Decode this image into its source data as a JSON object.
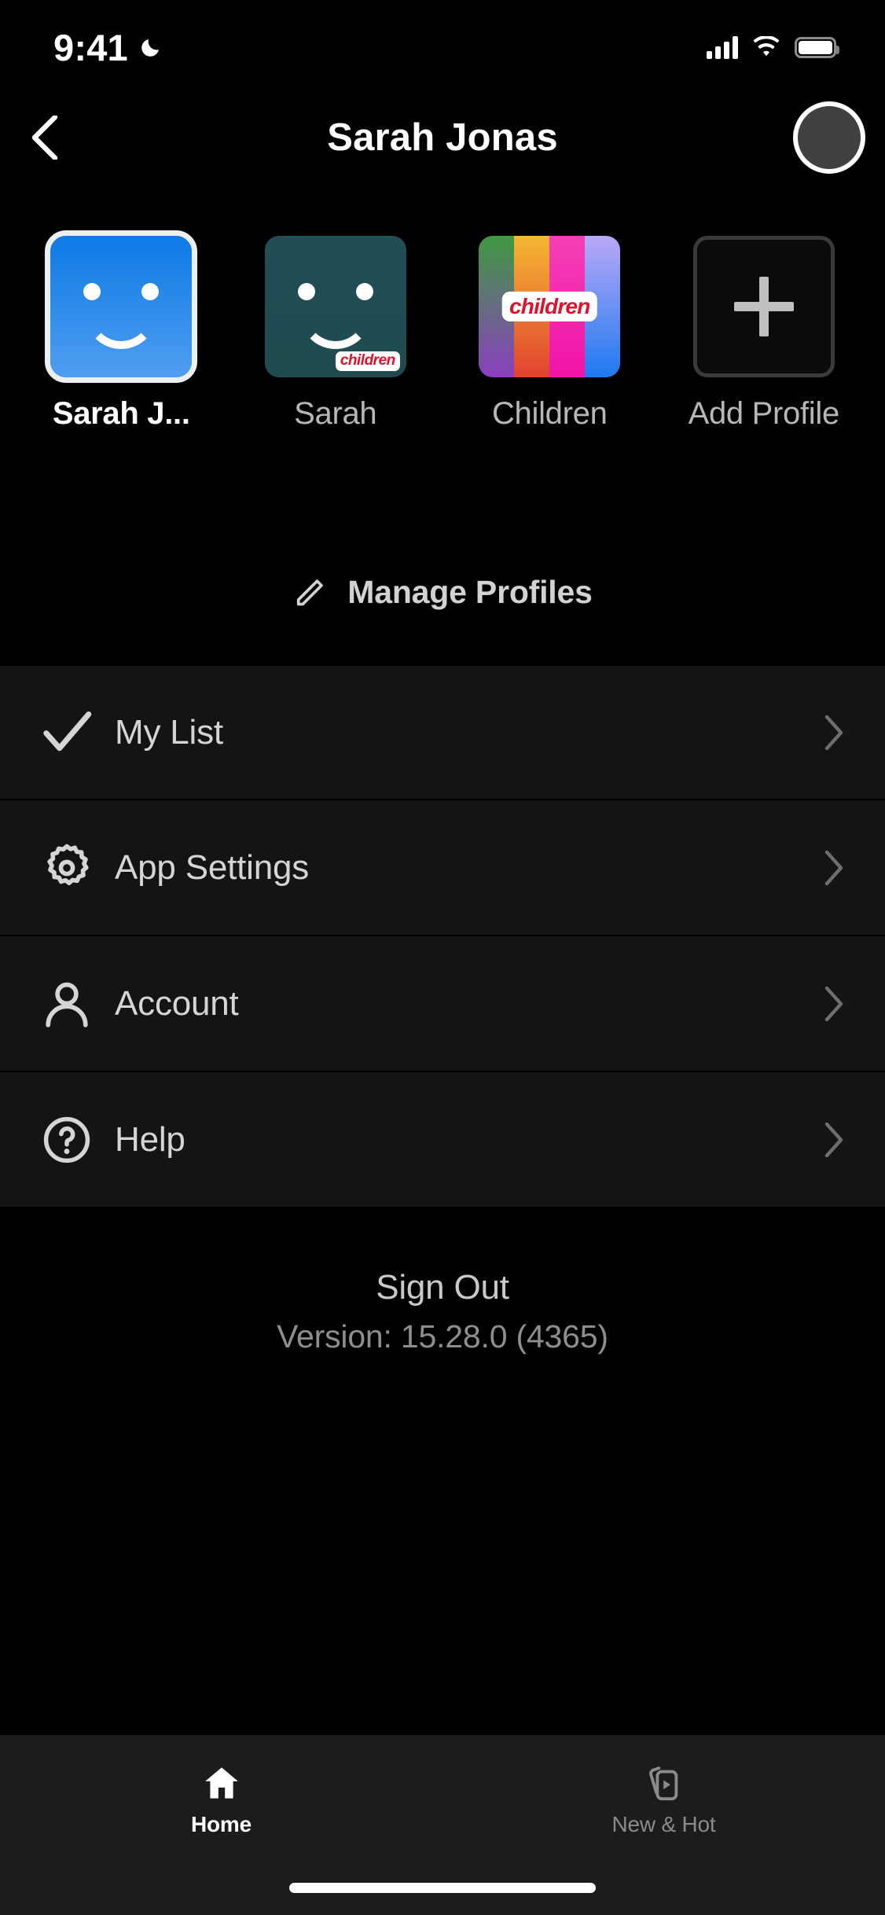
{
  "status_bar": {
    "time": "9:41",
    "dnd_icon": "moon-icon",
    "signal_icon": "cellular-signal-icon",
    "wifi_icon": "wifi-icon",
    "battery_icon": "battery-full-icon"
  },
  "header": {
    "back_icon": "back-chevron-icon",
    "title": "Sarah Jonas",
    "avatar": "profile-avatar"
  },
  "profiles": {
    "items": [
      {
        "label": "Sarah J...",
        "full_name": "Sarah Jonas",
        "type": "avatar-face",
        "color": "#0d7ae5",
        "selected": true,
        "kids": false
      },
      {
        "label": "Sarah",
        "type": "avatar-face",
        "color": "#214e55",
        "selected": false,
        "kids": true,
        "badge": "children"
      },
      {
        "label": "Children",
        "type": "avatar-stripes",
        "selected": false,
        "kids": true,
        "badge": "children"
      },
      {
        "label": "Add Profile",
        "type": "add-tile",
        "icon": "plus-icon",
        "selected": false,
        "kids": false
      }
    ]
  },
  "manage_profiles": {
    "icon": "pencil-icon",
    "label": "Manage Profiles"
  },
  "menu": {
    "items": [
      {
        "label": "My List",
        "icon": "checkmark-icon",
        "chevron": "chevron-right-icon"
      },
      {
        "label": "App Settings",
        "icon": "gear-icon",
        "chevron": "chevron-right-icon"
      },
      {
        "label": "Account",
        "icon": "person-icon",
        "chevron": "chevron-right-icon"
      },
      {
        "label": "Help",
        "icon": "question-circle-icon",
        "chevron": "chevron-right-icon"
      }
    ]
  },
  "footer": {
    "sign_out": "Sign Out",
    "version": "Version: 15.28.0 (4365)"
  },
  "tab_bar": {
    "tabs": [
      {
        "label": "Home",
        "icon": "house-icon",
        "active": true
      },
      {
        "label": "New & Hot",
        "icon": "new-and-hot-icon",
        "active": false
      }
    ]
  },
  "colors": {
    "background": "#000000",
    "row_background": "#141414",
    "tabbar_background": "#1c1c1c",
    "accent_selected": "#ffffff",
    "muted_text": "#8e8e8e",
    "kids_badge_red": "#e0112b"
  }
}
